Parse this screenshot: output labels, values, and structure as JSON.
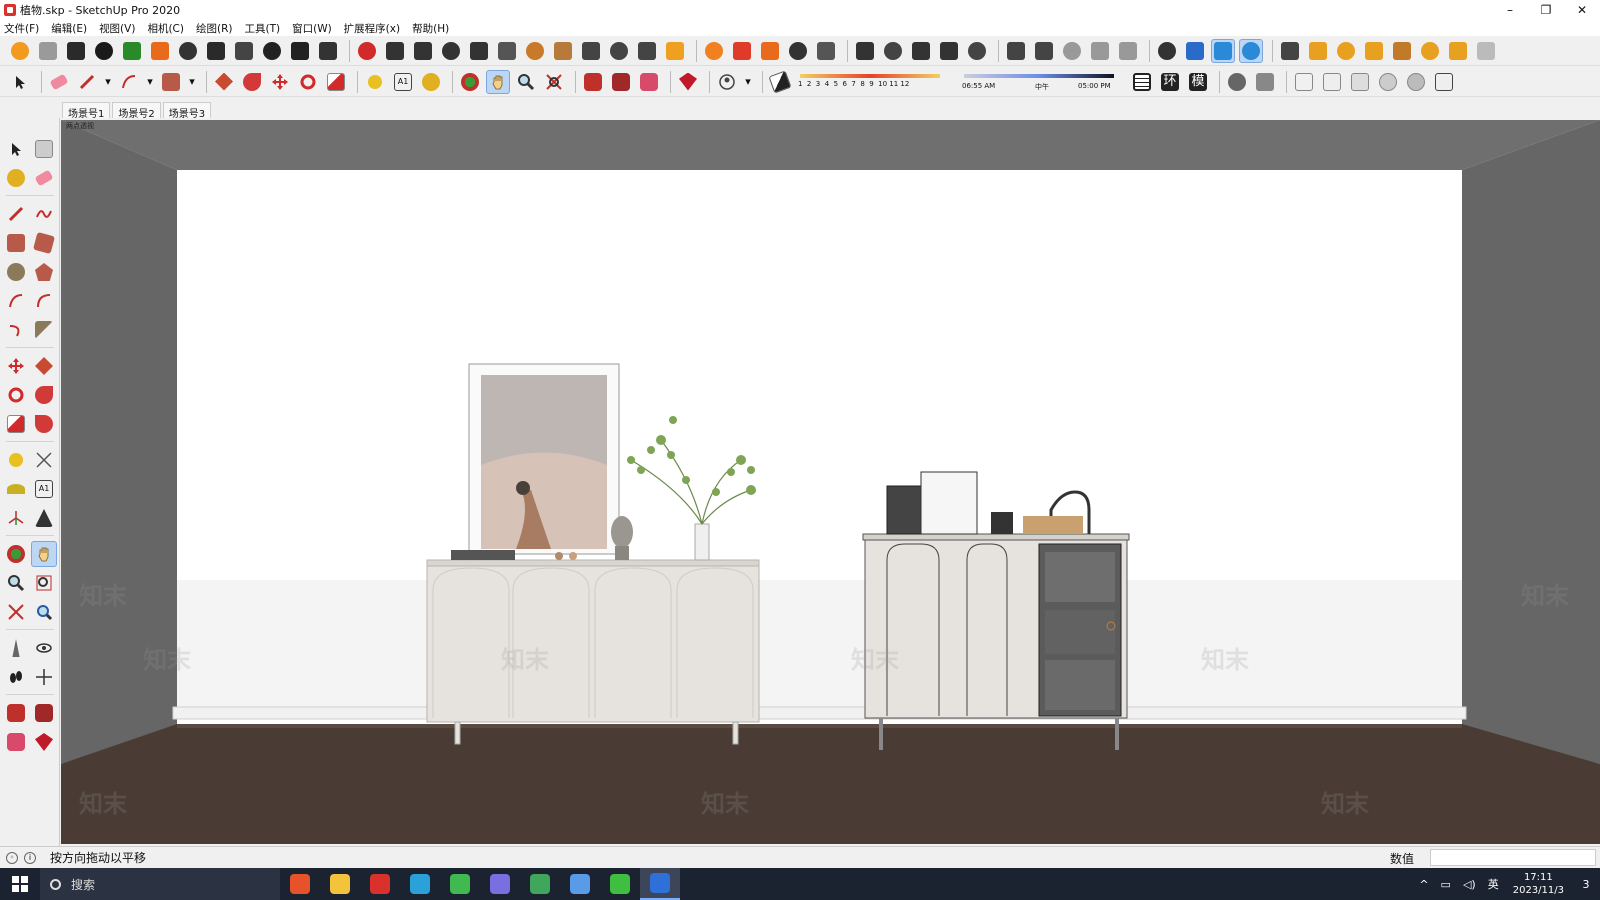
{
  "window": {
    "title": "植物.skp - SketchUp Pro 2020",
    "minimize_glyph": "–",
    "restore_glyph": "❐",
    "close_glyph": "✕"
  },
  "menu": [
    {
      "label": "文件(F)"
    },
    {
      "label": "编辑(E)"
    },
    {
      "label": "视图(V)"
    },
    {
      "label": "相机(C)"
    },
    {
      "label": "绘图(R)"
    },
    {
      "label": "工具(T)"
    },
    {
      "label": "窗口(W)"
    },
    {
      "label": "扩展程序(x)"
    },
    {
      "label": "帮助(H)"
    }
  ],
  "toolbar_top": {
    "icons": [
      "warehouse-icon",
      "refresh-icon",
      "stack-icon",
      "add-location-icon",
      "tree-icon",
      "house-icon",
      "checker-icon",
      "cloud-icon",
      "gear-icon",
      "mail-icon",
      "info-icon",
      "push-icon",
      "drop-icon",
      "align-icon",
      "curve-icon",
      "line-icon",
      "angle-icon",
      "hand-icon",
      "box-icon",
      "ruler-icon",
      "measure-icon",
      "camera-icon",
      "edit-icon",
      "sun-icon",
      "sun-icon",
      "fire-icon",
      "gear-icon",
      "vray-icon",
      "palette-icon",
      "teapot-icon",
      "render-icon",
      "orbit-icon",
      "loop-icon",
      "bed-icon",
      "frame-icon",
      "window-icon",
      "window-icon",
      "window-icon",
      "lock-icon",
      "cross-icon",
      "cube-icon",
      "cube-icon",
      "cube-icon",
      "scene-icon",
      "lamp-icon",
      "ring-icon",
      "cone-icon",
      "lamp-icon",
      "spark-icon",
      "dome-icon",
      "hexagon-icon"
    ]
  },
  "toolbar_second": {
    "shadow_months": "1  2  3  4  5  6  7  8  9  10 11 12",
    "time_start": "06:55 AM",
    "time_mid": "中午",
    "time_end": "05:00 PM",
    "extra_buttons": [
      "环",
      "模"
    ]
  },
  "scenes": [
    {
      "label": "场景号1"
    },
    {
      "label": "场景号2"
    },
    {
      "label": "场景号3"
    }
  ],
  "viewport": {
    "perspective_label": "两点透视",
    "watermark": "知末"
  },
  "status": {
    "hint": "按方向拖动以平移",
    "measurements_label": "数值",
    "measurements_value": ""
  },
  "taskbar": {
    "search_placeholder": "搜索",
    "ime": "英",
    "time": "17:11",
    "date": "2023/11/3",
    "notif_count": "3",
    "apps": [
      {
        "name": "listen-app-icon",
        "color": "#e8522a"
      },
      {
        "name": "file-explorer-icon",
        "color": "#f3c33b"
      },
      {
        "name": "wps-icon",
        "color": "#d9312b"
      },
      {
        "name": "edge-icon",
        "color": "#2aa1d8"
      },
      {
        "name": "browser-icon",
        "color": "#3fb950"
      },
      {
        "name": "photos-icon",
        "color": "#7a6fe0"
      },
      {
        "name": "terminal-icon",
        "color": "#3fa65b"
      },
      {
        "name": "app-icon",
        "color": "#5a9be8"
      },
      {
        "name": "wechat-icon",
        "color": "#3fbf3f"
      },
      {
        "name": "vray-taskbar-icon",
        "color": "#2f6fd8"
      }
    ]
  },
  "colors": {
    "accent": "#2f6fd8",
    "floor": "#4a3c34",
    "walls_side": "#6c6c6c",
    "ceiling": "#7a7a7a",
    "back_wall": "#ffffff",
    "cabinet": "#e8e5e0"
  }
}
